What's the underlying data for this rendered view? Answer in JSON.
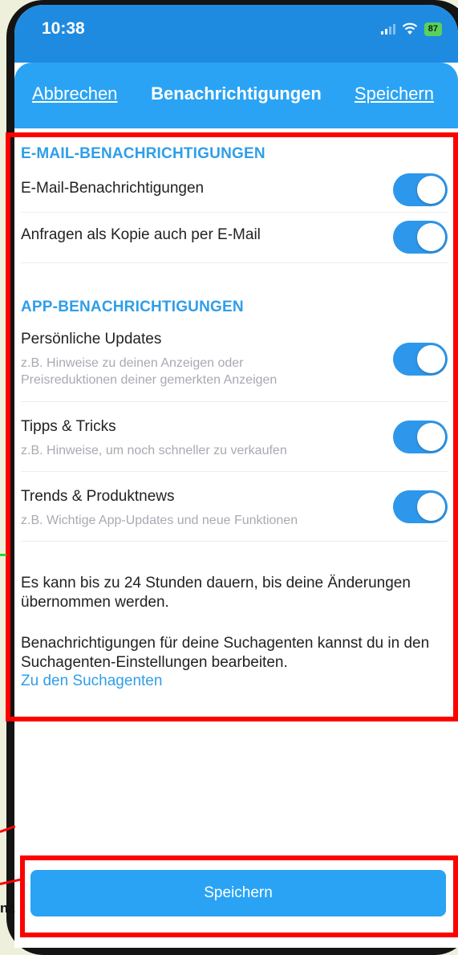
{
  "status_bar": {
    "time": "10:38",
    "battery": "87"
  },
  "nav": {
    "cancel_label": "Abbrechen",
    "title": "Benachrichtigungen",
    "save_label": "Speichern"
  },
  "email_section": {
    "header": "E-MAIL-BENACHRICHTIGUNGEN",
    "items": [
      {
        "label": "E-Mail-Benachrichtigungen",
        "enabled": true
      },
      {
        "label": "Anfragen als Kopie auch per E-Mail",
        "enabled": true
      }
    ]
  },
  "app_section": {
    "header": "APP-BENACHRICHTIGUNGEN",
    "items": [
      {
        "label": "Persönliche Updates",
        "description": "z.B. Hinweise zu deinen Anzeigen oder Preisreduktionen deiner gemerkten Anzeigen",
        "enabled": true
      },
      {
        "label": "Tipps & Tricks",
        "description": "z.B. Hinweise, um noch schneller zu verkaufen",
        "enabled": true
      },
      {
        "label": "Trends & Produktnews",
        "description": "z.B. Wichtige App-Updates und neue Funktionen",
        "enabled": true
      }
    ]
  },
  "info": {
    "delay_text": "Es kann bis zu 24 Stunden dauern, bis deine Änderungen übernommen werden.",
    "search_agent_text": "Benachrichtigungen für deine Suchagenten kannst du in den Suchagenten-Einstellungen bearbeiten.",
    "search_agent_link": "Zu den Suchagenten"
  },
  "footer": {
    "save_button": "Speichern"
  },
  "edge_fragment": "nz",
  "colors": {
    "accent": "#2aa3f4",
    "toggle_on": "#2d97eb",
    "section_header": "#2f9ee8",
    "annotation": "#ff0000"
  }
}
